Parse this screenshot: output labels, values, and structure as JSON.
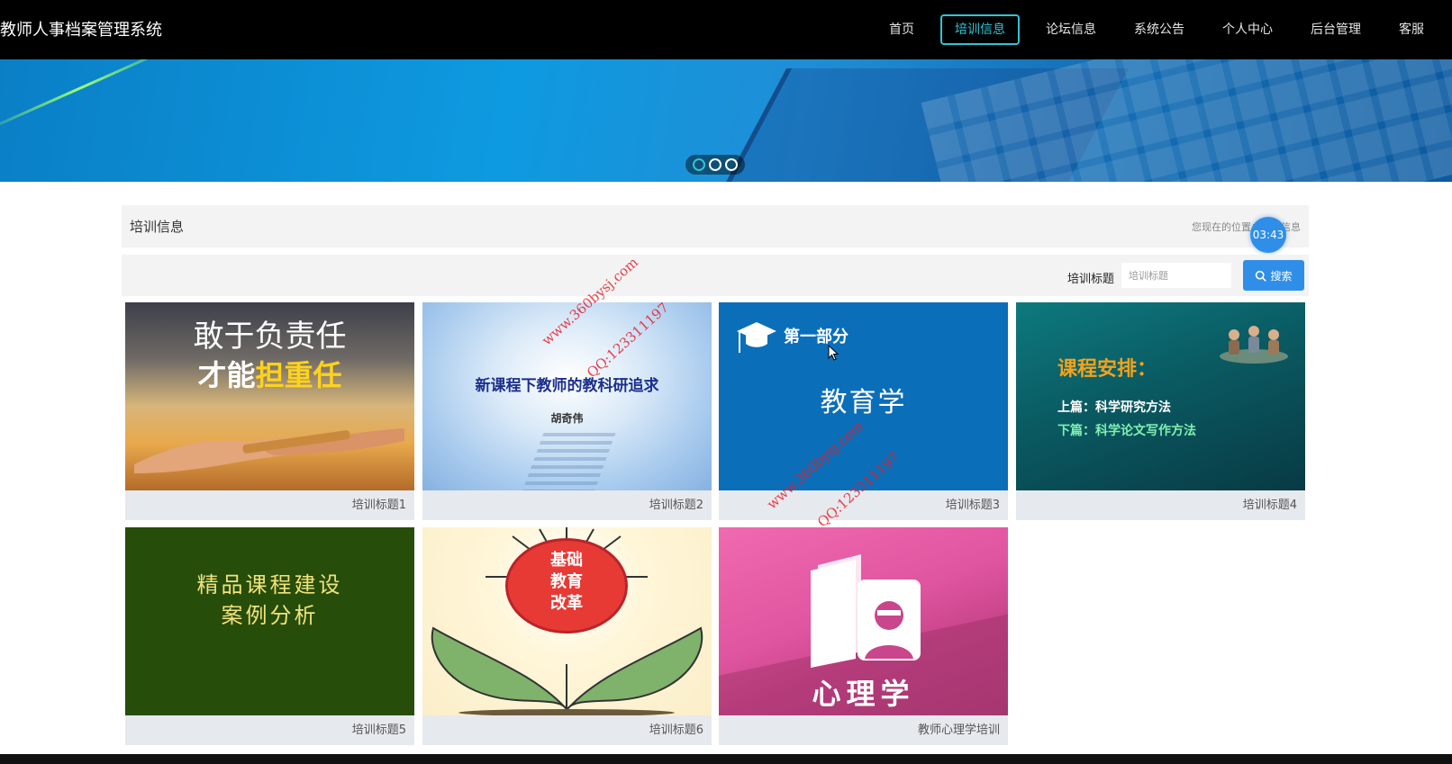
{
  "header": {
    "brand": "教师人事档案管理系统",
    "nav": [
      {
        "label": "首页",
        "active": false
      },
      {
        "label": "培训信息",
        "active": true
      },
      {
        "label": "论坛信息",
        "active": false
      },
      {
        "label": "系统公告",
        "active": false
      },
      {
        "label": "个人中心",
        "active": false
      },
      {
        "label": "后台管理",
        "active": false
      },
      {
        "label": "客服",
        "active": false
      }
    ]
  },
  "banner": {
    "slides": 3,
    "active_slide": 1
  },
  "section": {
    "title": "培训信息",
    "breadcrumb": "您现在的位置：培训信息"
  },
  "timer": "03:43",
  "search": {
    "label": "培训标题",
    "placeholder": "培训标题",
    "button_label": "搜索"
  },
  "cards": [
    {
      "caption": "培训标题1",
      "image_text": [
        "敢于负责任",
        "才能",
        "担重任"
      ]
    },
    {
      "caption": "培训标题2",
      "image_text": [
        "新课程下教师的教科研追求",
        "胡奇伟"
      ]
    },
    {
      "caption": "培训标题3",
      "image_text": [
        "第一部分",
        "教育学"
      ]
    },
    {
      "caption": "培训标题4",
      "image_text": [
        "课程安排：",
        "上篇：科学研究方法",
        "下篇：科学论文写作方法"
      ]
    },
    {
      "caption": "培训标题5",
      "image_text": [
        "精品课程建设",
        "案例分析"
      ]
    },
    {
      "caption": "培训标题6",
      "image_text": [
        "基础",
        "教育",
        "改革"
      ]
    },
    {
      "caption": "教师心理学培训",
      "image_text": [
        "心理学"
      ]
    }
  ],
  "watermarks": [
    {
      "text": "www.360bysj.com"
    },
    {
      "text": "QQ:123311197"
    },
    {
      "text": "www.360bysj.com"
    },
    {
      "text": "QQ:123311197"
    }
  ],
  "colors": {
    "accent": "#2ec5d6",
    "primary_button": "#2f8fe8",
    "header_bg": "#000000",
    "panel_bg": "#f3f3f3",
    "card_caption_bg": "#e6e9ee"
  },
  "icons": {
    "search_button_icon": "search-icon"
  }
}
